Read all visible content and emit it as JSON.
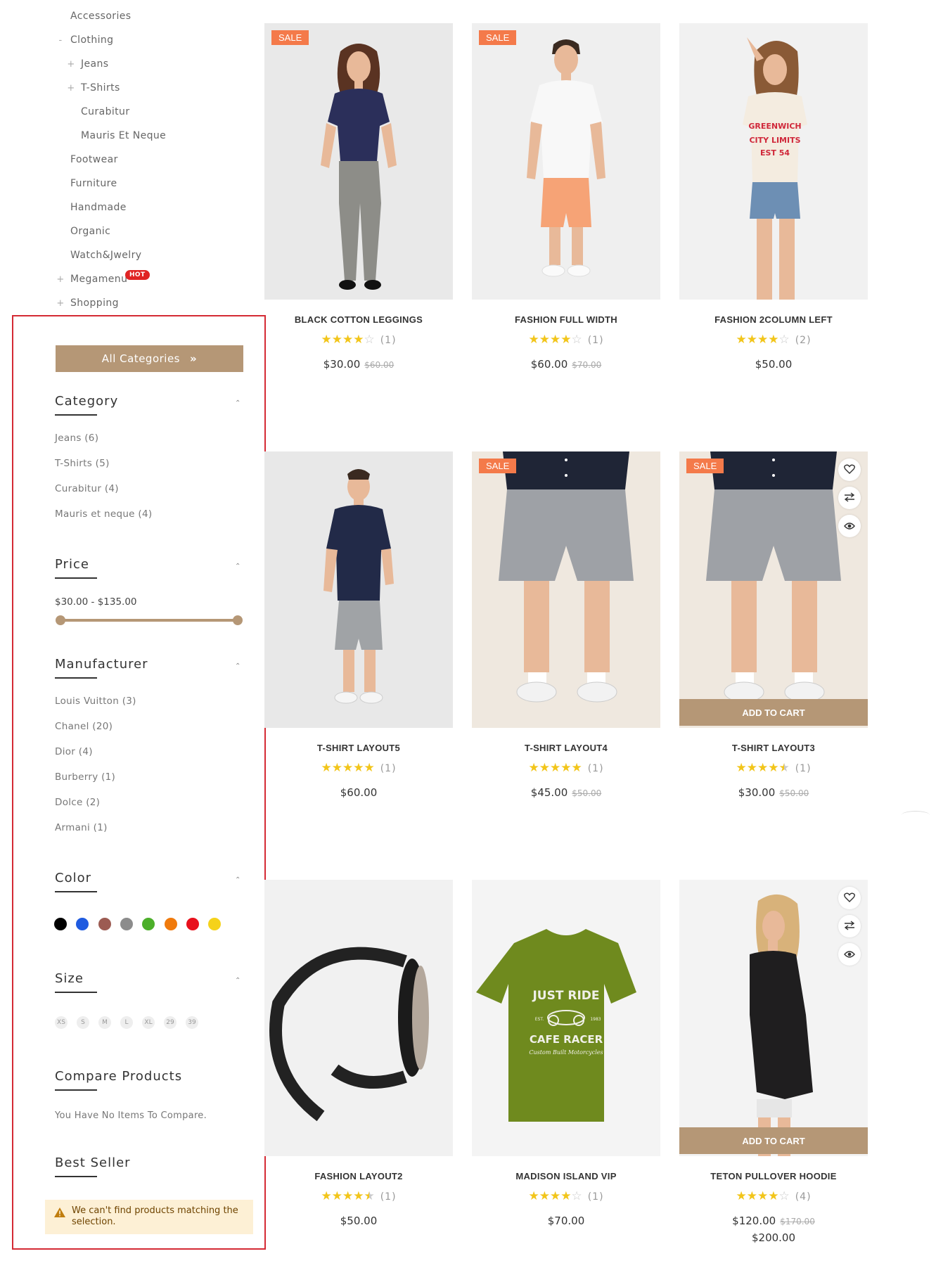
{
  "category_tree": [
    {
      "label": "Accessories",
      "marker": "",
      "indent": 0
    },
    {
      "label": "Clothing",
      "marker": "-",
      "indent": 0
    },
    {
      "label": "Jeans",
      "marker": "+",
      "indent": 1
    },
    {
      "label": "T-Shirts",
      "marker": "+",
      "indent": 1
    },
    {
      "label": "Curabitur",
      "marker": "",
      "indent": 1
    },
    {
      "label": "Mauris Et Neque",
      "marker": "",
      "indent": 1
    },
    {
      "label": "Footwear",
      "marker": "",
      "indent": 0
    },
    {
      "label": "Furniture",
      "marker": "",
      "indent": 0
    },
    {
      "label": "Handmade",
      "marker": "",
      "indent": 0
    },
    {
      "label": "Organic",
      "marker": "",
      "indent": 0
    },
    {
      "label": "Watch&Jwelry",
      "marker": "",
      "indent": 0
    },
    {
      "label": "Megamenu",
      "marker": "+",
      "indent": 0,
      "badge": "HOT"
    },
    {
      "label": "Shopping",
      "marker": "+",
      "indent": 0
    }
  ],
  "all_categories_label": "All Categories",
  "filters": {
    "category": {
      "title": "Category",
      "items": [
        "Jeans (6)",
        "T-Shirts (5)",
        "Curabitur (4)",
        "Mauris et neque (4)"
      ]
    },
    "price": {
      "title": "Price",
      "range_text": "$30.00 - $135.00",
      "min": 30,
      "max": 135
    },
    "manufacturer": {
      "title": "Manufacturer",
      "items": [
        "Louis Vuitton (3)",
        "Chanel (20)",
        "Dior (4)",
        "Burberry (1)",
        "Dolce (2)",
        "Armani (1)"
      ]
    },
    "color": {
      "title": "Color",
      "swatches": [
        "#000000",
        "#1f5be0",
        "#9c5b52",
        "#8c8c8c",
        "#4caf2a",
        "#f07a0c",
        "#e8101c",
        "#f5d21a"
      ]
    },
    "size": {
      "title": "Size",
      "options": [
        "XS",
        "S",
        "M",
        "L",
        "XL",
        "29",
        "39"
      ]
    },
    "compare": {
      "title": "Compare Products",
      "empty_text": "You Have No Items To Compare."
    },
    "best_seller": {
      "title": "Best Seller",
      "notice": "We can't find products matching the selection."
    }
  },
  "colors": {
    "accent": "#b59776",
    "sale": "#f47a4a",
    "star": "#f2c51a",
    "hot": "#e02424",
    "highlight_border": "#d42a34"
  },
  "products": [
    {
      "name": "BLACK COTTON LEGGINGS",
      "stars": 4,
      "count": "(1)",
      "price": "$30.00",
      "old_price": "$60.00",
      "sale": "SALE",
      "image": "woman-navy-tee-leggings"
    },
    {
      "name": "FASHION FULL WIDTH",
      "stars": 4,
      "count": "(1)",
      "price": "$60.00",
      "old_price": "$70.00",
      "sale": "SALE",
      "image": "man-white-tee-orange-shorts"
    },
    {
      "name": "FASHION 2COLUMN LEFT",
      "stars": 4,
      "count": "(2)",
      "price": "$50.00",
      "image": "woman-graphic-tee-denim-shorts"
    },
    {
      "name": "T-SHIRT LAYOUT5",
      "stars": 5,
      "count": "(1)",
      "price": "$60.00",
      "image": "man-navy-shirt-grey-shorts"
    },
    {
      "name": "T-SHIRT LAYOUT4",
      "stars": 5,
      "count": "(1)",
      "price": "$45.00",
      "old_price": "$50.00",
      "sale": "SALE",
      "image": "grey-shorts-closeup"
    },
    {
      "name": "T-SHIRT LAYOUT3",
      "stars": 4.5,
      "count": "(1)",
      "price": "$30.00",
      "old_price": "$50.00",
      "sale": "SALE",
      "image": "grey-shorts-closeup",
      "hover": true,
      "add_to_cart": "ADD TO CART"
    },
    {
      "name": "FASHION LAYOUT2",
      "stars": 4.5,
      "count": "(1)",
      "price": "$50.00",
      "image": "black-watch"
    },
    {
      "name": "MADISON ISLAND VIP",
      "stars": 4,
      "count": "(1)",
      "price": "$70.00",
      "image": "green-tshirt-cafe-racer",
      "tshirt_text": [
        "JUST RIDE",
        "EST.",
        "1983",
        "CAFE RACER",
        "Custom Built Motorcycles"
      ]
    },
    {
      "name": "TETON PULLOVER HOODIE",
      "stars": 4,
      "count": "(4)",
      "price": "$120.00",
      "old_price": "$170.00",
      "price2": "$200.00",
      "image": "woman-black-top",
      "hover": true,
      "add_to_cart": "ADD TO CART"
    }
  ]
}
